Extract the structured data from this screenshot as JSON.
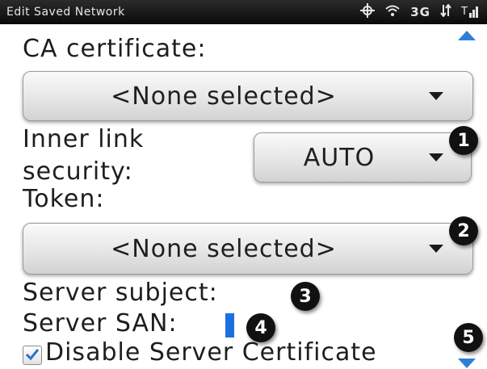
{
  "status_bar": {
    "title": "Edit Saved Network",
    "network": "3G",
    "icons": [
      "gps-icon",
      "wifi-icon",
      "data-arrows-icon",
      "signal-strength-icon"
    ]
  },
  "form": {
    "ca_certificate": {
      "label": "CA certificate:",
      "value": "<None selected>"
    },
    "inner_link_security": {
      "label_line1": "Inner link",
      "label_line2": "security:",
      "value": "AUTO"
    },
    "token": {
      "label": "Token:",
      "value": "<None selected>"
    },
    "server_subject": {
      "label": "Server subject:",
      "value": ""
    },
    "server_san": {
      "label": "Server SAN:",
      "value": ""
    },
    "disable_server_certificate": {
      "label": "Disable Server Certificate",
      "checked": true
    }
  },
  "callouts": [
    "1",
    "2",
    "3",
    "4",
    "5"
  ],
  "colors": {
    "status_bar_bg": "#111111",
    "accent": "#2f7fd6",
    "cursor": "#1c6fe0",
    "callout_bg": "#111111"
  }
}
